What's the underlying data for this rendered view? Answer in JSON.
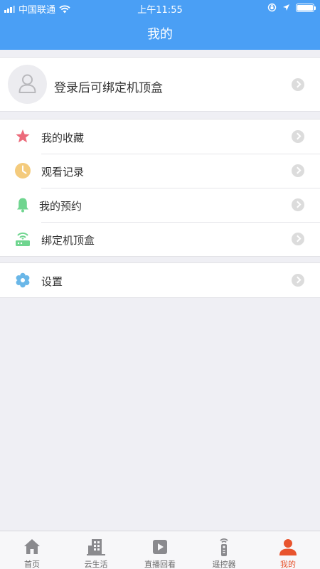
{
  "status_bar": {
    "carrier": "中国联通",
    "time": "上午11:55"
  },
  "nav": {
    "title": "我的"
  },
  "login": {
    "prompt": "登录后可绑定机顶盒"
  },
  "menu": [
    {
      "label": "我的收藏",
      "icon": "star-icon",
      "color": "#ec6a7a"
    },
    {
      "label": "观看记录",
      "icon": "clock-icon",
      "color": "#f4cb7d"
    },
    {
      "label": "我的预约",
      "icon": "bell-icon",
      "color": "#6fd58f"
    },
    {
      "label": "绑定机顶盒",
      "icon": "router-icon",
      "color": "#6fd58f"
    }
  ],
  "settings": {
    "label": "设置",
    "icon": "gear-icon",
    "color": "#6ab7e8"
  },
  "tabs": [
    {
      "label": "首页",
      "icon": "home-icon"
    },
    {
      "label": "云生活",
      "icon": "building-icon"
    },
    {
      "label": "直播回看",
      "icon": "play-icon"
    },
    {
      "label": "遥控器",
      "icon": "remote-icon"
    },
    {
      "label": "我的",
      "icon": "user-icon",
      "active": true
    }
  ],
  "colors": {
    "header": "#4a9ff5",
    "active_tab": "#e8542e",
    "tab_inactive": "#666666",
    "background": "#efeff4"
  }
}
